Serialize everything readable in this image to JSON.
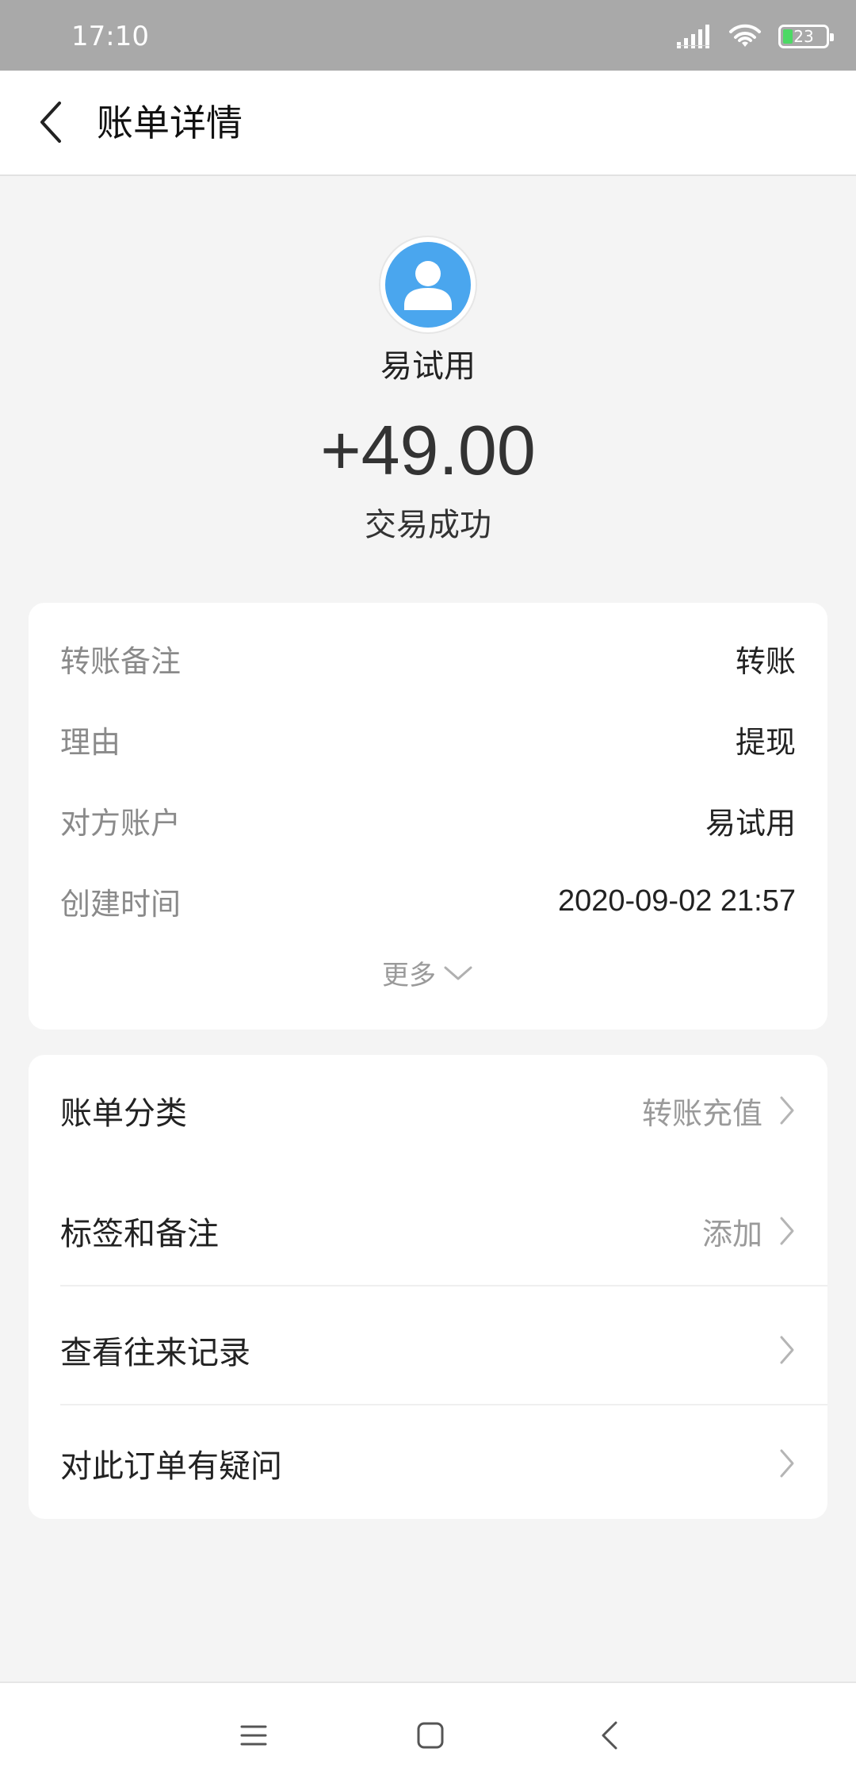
{
  "status_bar": {
    "time": "17:10",
    "battery_level": "23",
    "battery_fraction": 0.23,
    "icons": [
      "signal-icon",
      "wifi-icon",
      "battery-icon"
    ]
  },
  "header": {
    "title": "账单详情",
    "back_icon": "chevron-left-icon"
  },
  "summary": {
    "avatar_icon": "user-avatar-icon",
    "name": "易试用",
    "amount": "+49.00",
    "status": "交易成功"
  },
  "details": {
    "rows": [
      {
        "label": "转账备注",
        "value": "转账"
      },
      {
        "label": "理由",
        "value": "提现"
      },
      {
        "label": "对方账户",
        "value": "易试用"
      },
      {
        "label": "创建时间",
        "value": "2020-09-02 21:57"
      }
    ],
    "more_label": "更多",
    "more_icon": "chevron-down-icon"
  },
  "actions": {
    "items": [
      {
        "label": "账单分类",
        "value": "转账充值"
      },
      {
        "label": "标签和备注",
        "value": "添加"
      },
      {
        "label": "查看往来记录",
        "value": ""
      },
      {
        "label": "对此订单有疑问",
        "value": ""
      }
    ],
    "chevron_icon": "chevron-right-icon"
  },
  "nav_bar": {
    "icons": [
      "menu-icon",
      "home-square-icon",
      "back-triangle-icon"
    ]
  },
  "colors": {
    "status_bar_bg": "#a9a9a9",
    "page_bg": "#f4f4f4",
    "avatar_blue": "#4aa6ee",
    "battery_green": "#4cd964"
  }
}
